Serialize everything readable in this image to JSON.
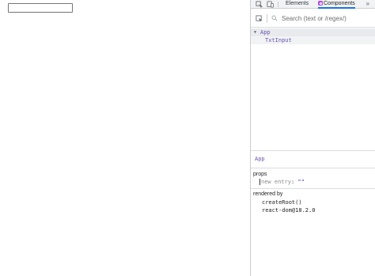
{
  "page": {
    "txt_input_value": ""
  },
  "devtools": {
    "tabs": [
      {
        "label": "Elements",
        "active": false
      },
      {
        "label": "Components",
        "active": true
      }
    ],
    "more_tabs_glyph": "»",
    "search_placeholder": "Search (text or /regex/)",
    "tree": [
      {
        "name": "App",
        "expanded": true,
        "selected": true
      },
      {
        "name": "TxtInput",
        "selected": false
      }
    ],
    "inspected": {
      "component_name": "App",
      "props_title": "props",
      "new_entry_key": "new entry",
      "new_entry_colon": ":",
      "new_entry_value": "\"\"",
      "rendered_by_title": "rendered by",
      "rendered_by": [
        "createRoot()",
        "react-dom@18.2.0"
      ]
    },
    "colors": {
      "accent": "#1a73e8",
      "component_name": "#6a51b2",
      "string_value": "#1a1aa6",
      "react_badge": "#b150e0"
    }
  }
}
